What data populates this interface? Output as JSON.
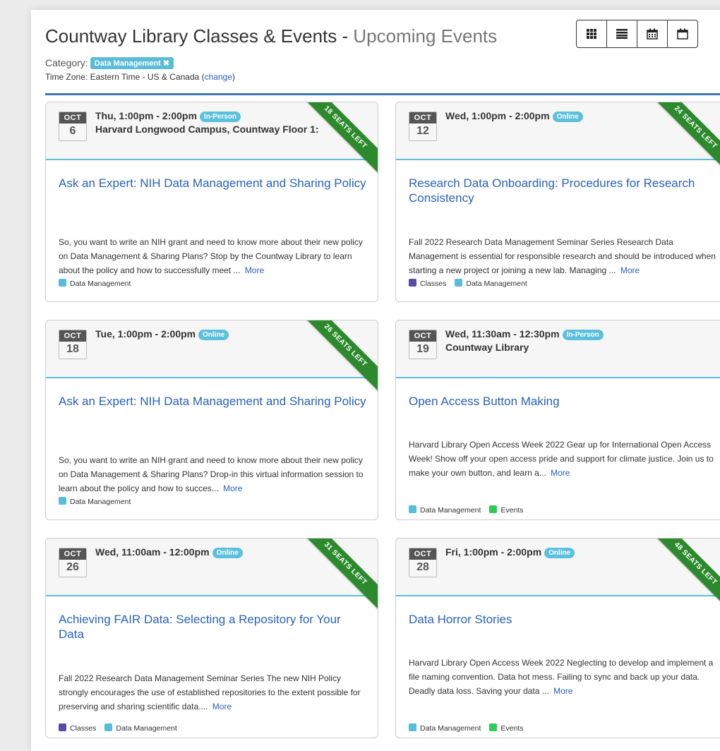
{
  "page": {
    "title_main": "Countway Library Classes & Events - ",
    "title_sub": "Upcoming Events",
    "category_label": "Category:",
    "category_badge": "Data Management ✖",
    "timezone_label": "Time Zone: Eastern Time - US & Canada (",
    "timezone_change": "change",
    "timezone_close": ")"
  },
  "view_toggle": [
    {
      "icon": "grid-icon"
    },
    {
      "icon": "list-icon"
    },
    {
      "icon": "calendar-month-icon"
    },
    {
      "icon": "calendar-icon"
    }
  ],
  "colors": {
    "accent": "#3a75b5",
    "link": "#2a62b6",
    "tag_data_management": "#59bcd8",
    "tag_classes": "#5a4aa8",
    "tag_events": "#2ecc54",
    "ribbon": "#2c8a2c"
  },
  "events": [
    {
      "month": "OCT",
      "day": "6",
      "when": "Thu, 1:00pm - 2:00pm",
      "mode": "In-Person",
      "location": "Harvard Longwood Campus, Countway Floor 1:",
      "seats": "18 SEATS LEFT",
      "title": "Ask an Expert: NIH Data Management and Sharing Policy",
      "desc": "So, you want to write an NIH grant and need to know more about their new policy on Data Management & Sharing Plans? Stop by the Countway Library to learn about the policy and how to successfully meet ...",
      "more": "More",
      "tags": [
        "Data Management"
      ]
    },
    {
      "month": "OCT",
      "day": "12",
      "when": "Wed, 1:00pm - 2:00pm",
      "mode": "Online",
      "location": "",
      "seats": "24 SEATS LEFT",
      "title": "Research Data Onboarding: Procedures for Research Consistency",
      "desc": "Fall 2022 Research Data Management Seminar Series Research Data Management is essential for responsible research and should be introduced when starting a new project or joining a new lab. Managing ...",
      "more": "More",
      "tags": [
        "Classes",
        "Data Management"
      ]
    },
    {
      "month": "OCT",
      "day": "18",
      "when": "Tue, 1:00pm - 2:00pm",
      "mode": "Online",
      "location": "",
      "seats": "26 SEATS LEFT",
      "title": "Ask an Expert: NIH Data Management and Sharing Policy",
      "desc": "So, you want to write an NIH grant and need to know more about their new policy on Data Management & Sharing Plans? Drop-in this virtual information session to learn about the policy and how to succes...",
      "more": "More",
      "tags": [
        "Data Management"
      ]
    },
    {
      "month": "OCT",
      "day": "19",
      "when": "Wed, 11:30am - 12:30pm",
      "mode": "In-Person",
      "location": "Countway Library",
      "seats": "",
      "title": "Open Access Button Making",
      "desc": "Harvard Library Open Access Week 2022 Gear up for International Open Access Week! Show off your open access pride and support for climate justice. Join us to make your own button, and learn a...",
      "more": "More",
      "tags": [
        "Data Management",
        "Events"
      ]
    },
    {
      "month": "OCT",
      "day": "26",
      "when": "Wed, 11:00am - 12:00pm",
      "mode": "Online",
      "location": "",
      "seats": "31 SEATS LEFT",
      "title": "Achieving FAIR Data: Selecting a Repository for Your Data",
      "desc": "Fall 2022 Research Data Management Seminar Series The new NIH Policy strongly encourages the use of established repositories to the extent possible for preserving and sharing scientific data....",
      "more": "More",
      "tags": [
        "Classes",
        "Data Management"
      ]
    },
    {
      "month": "OCT",
      "day": "28",
      "when": "Fri, 1:00pm - 2:00pm",
      "mode": "Online",
      "location": "",
      "seats": "48 SEATS LEFT",
      "title": "Data Horror Stories",
      "desc": "Harvard Library Open Access Week 2022 Neglecting to develop and implement a file naming convention. Data hot mess. Failing to sync and back up your data. Deadly data loss. Saving your data ...",
      "more": "More",
      "tags": [
        "Data Management",
        "Events"
      ]
    }
  ]
}
